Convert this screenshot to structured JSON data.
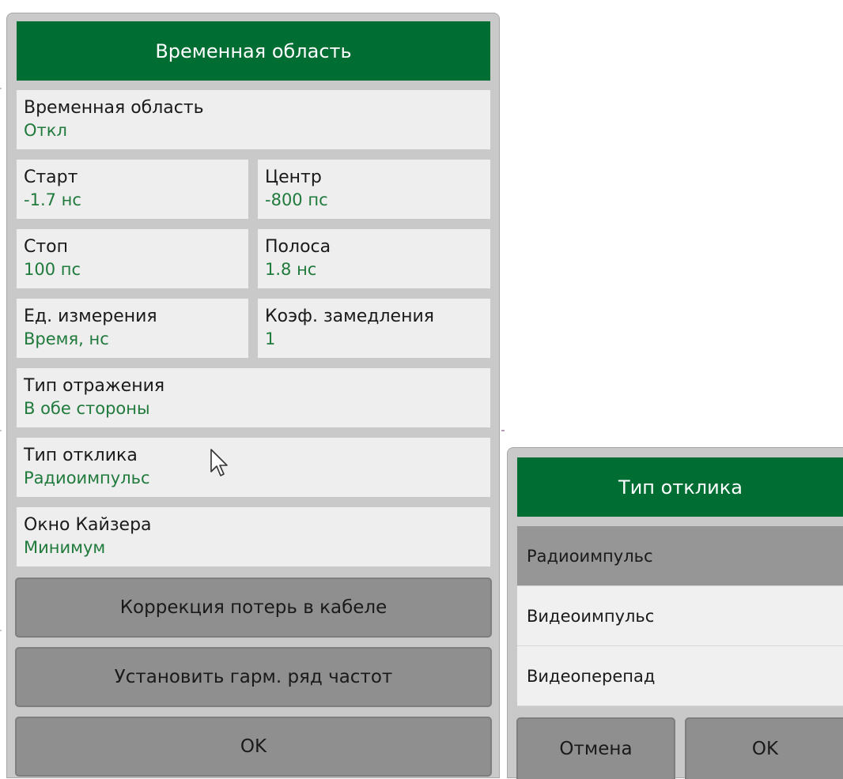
{
  "main_dialog": {
    "title": "Временная область",
    "time_domain": {
      "label": "Временная область",
      "value": "Откл"
    },
    "start": {
      "label": "Старт",
      "value": "-1.7 нс"
    },
    "center": {
      "label": "Центр",
      "value": "-800 пс"
    },
    "stop": {
      "label": "Стоп",
      "value": "100 пс"
    },
    "span": {
      "label": "Полоса",
      "value": "1.8 нс"
    },
    "units": {
      "label": "Ед. измерения",
      "value": "Время, нс"
    },
    "velocity_factor": {
      "label": "Коэф. замедления",
      "value": "1"
    },
    "reflection_type": {
      "label": "Тип отражения",
      "value": "В обе стороны"
    },
    "response_type": {
      "label": "Тип отклика",
      "value": "Радиоимпульс"
    },
    "window": {
      "label": "Окно Кайзера",
      "value": "Минимум"
    },
    "cable_loss_button": "Коррекция потерь в кабеле",
    "harmonic_button": "Установить гарм. ряд частот",
    "ok_button": "OK"
  },
  "response_popup": {
    "title": "Тип отклика",
    "options": [
      {
        "label": "Радиоимпульс",
        "selected": true
      },
      {
        "label": "Видеоимпульс",
        "selected": false
      },
      {
        "label": "Видеоперепад",
        "selected": false
      }
    ],
    "cancel_button": "Отмена",
    "ok_button": "OK"
  },
  "colors": {
    "header_green": "#006d33",
    "value_green": "#1f7a3c",
    "selected_option": "#969696",
    "button_gray": "#8f8f8f"
  }
}
